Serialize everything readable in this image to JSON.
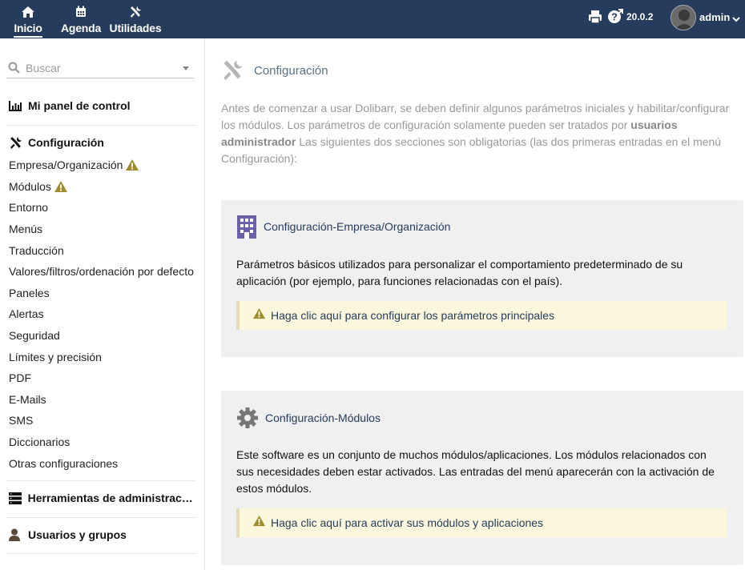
{
  "topnav": {
    "items": [
      {
        "label": "Inicio",
        "icon": "home-icon",
        "active": true
      },
      {
        "label": "Agenda",
        "icon": "calendar-icon"
      },
      {
        "label": "Utilidades",
        "icon": "tools-icon"
      }
    ],
    "version": "20.0.2",
    "username": "admin"
  },
  "sidebar": {
    "search_placeholder": "Buscar",
    "dashboard": "Mi panel de control",
    "config_title": "Configuración",
    "config_items": [
      {
        "label": "Empresa/Organización",
        "warning": true
      },
      {
        "label": "Módulos",
        "warning": true
      },
      {
        "label": "Entorno"
      },
      {
        "label": "Menús"
      },
      {
        "label": "Traducción"
      },
      {
        "label": "Valores/filtros/ordenación por defecto"
      },
      {
        "label": "Paneles"
      },
      {
        "label": "Alertas"
      },
      {
        "label": "Seguridad"
      },
      {
        "label": "Límites y precisión"
      },
      {
        "label": "PDF"
      },
      {
        "label": "E-Mails"
      },
      {
        "label": "SMS"
      },
      {
        "label": "Diccionarios"
      },
      {
        "label": "Otras configuraciones"
      }
    ],
    "admin_tools": "Herramientas de administración",
    "users_groups": "Usuarios y grupos"
  },
  "main": {
    "title": "Configuración",
    "intro_before": "Antes de comenzar a usar Dolibarr, se deben definir algunos parámetros iniciales y habilitar/configurar los módulos. Los parámetros de configuración solamente pueden ser tratados por ",
    "intro_bold": "usuarios administrador",
    "intro_after": " Las siguientes dos secciones son obligatorias (las dos primeras entradas en el menú Configuración):",
    "card_company": {
      "title": "Configuración-Empresa/Organización",
      "text": "Parámetros básicos utilizados para personalizar el comportamiento predeterminado de su aplicación (por ejemplo, para funciones relacionadas con el país).",
      "callout": "Haga clic aquí para configurar los parámetros principales"
    },
    "card_modules": {
      "title": "Configuración-Módulos",
      "text": "Este software es un conjunto de muchos módulos/aplicaciones. Los módulos relacionados con sus necesidades deben estar activados. Las entradas del menú aparecerán con la activación de estos módulos.",
      "callout": "Haga clic aquí para activar sus módulos y aplicaciones"
    }
  },
  "colors": {
    "topbar": "#263c5c",
    "link": "#263c5c",
    "warning": "#a08a2a",
    "callout_bg": "#faf7dc",
    "card_bg": "#f0f0f0"
  }
}
